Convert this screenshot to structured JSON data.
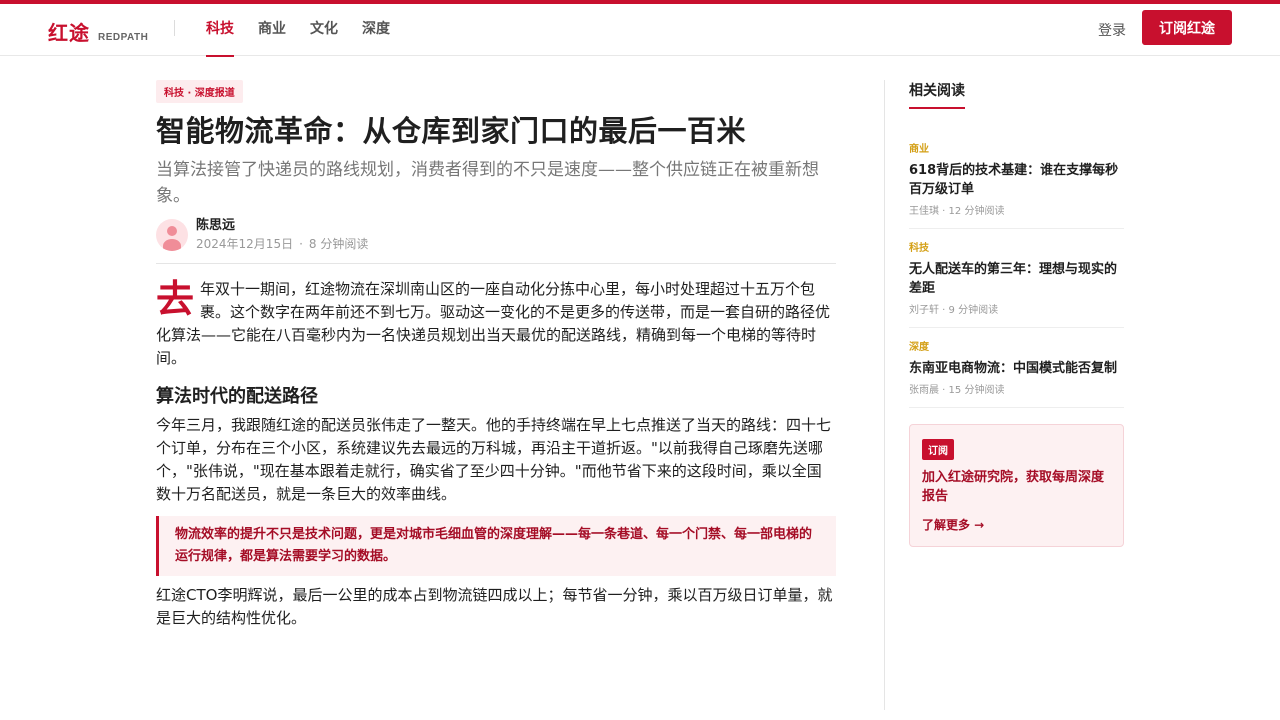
{
  "header": {
    "logo_cn": "红途",
    "logo_en": "REDPATH",
    "nav": [
      {
        "label": "科技",
        "active": true
      },
      {
        "label": "商业",
        "active": false
      },
      {
        "label": "文化",
        "active": false
      },
      {
        "label": "深度",
        "active": false
      }
    ],
    "login_label": "登录",
    "subscribe_label": "订阅红途"
  },
  "article": {
    "badge": "科技 · 深度报道",
    "title": "智能物流革命：从仓库到家门口的最后一百米",
    "subtitle": "当算法接管了快递员的路线规划，消费者得到的不只是速度——整个供应链正在被重新想象。",
    "author": "陈思远",
    "date": "2024年12月15日",
    "meta_separator": "·",
    "read_time": "8 分钟阅读",
    "dropcap": "去",
    "intro_rest": "年双十一期间，红途物流在深圳南山区的一座自动化分拣中心里，每小时处理超过十五万个包裹。这个数字在两年前还不到七万。驱动这一变化的不是更多的传送带，而是一套自研的路径优化算法——它能在八百毫秒内为一名快递员规划出当天最优的配送路线，精确到每一个电梯的等待时间。",
    "section_heading": "算法时代的配送路径",
    "section_para": "今年三月，我跟随红途的配送员张伟走了一整天。他的手持终端在早上七点推送了当天的路线：四十七个订单，分布在三个小区，系统建议先去最远的万科城，再沿主干道折返。\"以前我得自己琢磨先送哪个，\"张伟说，\"现在基本跟着走就行，确实省了至少四十分钟。\"而他节省下来的这段时间，乘以全国数十万名配送员，就是一条巨大的效率曲线。",
    "quote": "物流效率的提升不只是技术问题，更是对城市毛细血管的深度理解——每一条巷道、每一个门禁、每一部电梯的运行规律，都是算法需要学习的数据。",
    "closing_para": "红途CTO李明辉说，最后一公里的成本占到物流链四成以上；每节省一分钟，乘以百万级日订单量，就是巨大的结构性优化。"
  },
  "sidebar": {
    "title": "相关阅读",
    "items": [
      {
        "category": "商业",
        "headline": "618背后的技术基建：谁在支撑每秒百万级订单",
        "meta": "王佳琪 · 12 分钟阅读"
      },
      {
        "category": "科技",
        "headline": "无人配送车的第三年：理想与现实的差距",
        "meta": "刘子轩 · 9 分钟阅读"
      },
      {
        "category": "深度",
        "headline": "东南亚电商物流：中国模式能否复制",
        "meta": "张雨晨 · 15 分钟阅读"
      }
    ],
    "promo": {
      "tag": "订阅",
      "text": "加入红途研究院，获取每周深度报告",
      "link": "了解更多 →"
    }
  },
  "colors": {
    "brand": "#c8102e",
    "category": "#d4a017",
    "quote_bg": "#fdf1f2"
  }
}
